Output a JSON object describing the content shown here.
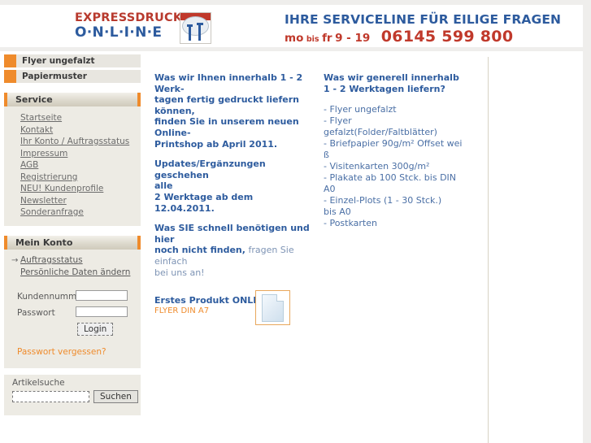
{
  "header": {
    "logo": {
      "line1": "EXPRESSDRUCK",
      "line2": "O·N·L·I·N·E",
      "mark_name": "speedometer-logo-icon"
    },
    "serviceline": {
      "headline": "IHRE SERVICELINE FÜR EILIGE FRAGEN",
      "days_from": "mo",
      "days_conj": "bis",
      "days_to": "fr",
      "hours": "9 - 19",
      "phone": "06145 599 800"
    }
  },
  "sidebar": {
    "categories": [
      {
        "label": "Flyer ungefalzt"
      },
      {
        "label": "Papiermuster"
      }
    ],
    "service": {
      "title": "Service",
      "items": [
        "Startseite",
        "Kontakt",
        "Ihr Konto / Auftragsstatus",
        "Impressum",
        "AGB",
        "Registrierung",
        "NEU! Kundenprofile",
        "Newsletter",
        "Sonderanfrage"
      ]
    },
    "account": {
      "title": "Mein Konto",
      "links": [
        {
          "label": "Auftragsstatus",
          "arrow": "→"
        },
        {
          "label": "Persönliche Daten ändern",
          "arrow": ""
        }
      ],
      "customer_number_label": "Kundennummer",
      "customer_number_value": "",
      "password_label": "Passwort",
      "password_value": "",
      "login_label": "Login",
      "forgot_label": "Passwort vergessen?"
    },
    "search": {
      "label": "Artikelsuche",
      "value": "",
      "button_label": "Suchen"
    }
  },
  "main": {
    "left": {
      "p1_l1": "Was wir Ihnen innerhalb 1 - 2 Werk-",
      "p1_l2": "tagen fertig gedruckt liefern",
      "p1_l3": "können,",
      "p1_l4": "finden Sie in unserem neuen",
      "p1_l5": "Online-",
      "p1_l6": "Printshop ab April 2011.",
      "p2_l1": "Updates/Ergänzungen geschehen",
      "p2_l2": "alle",
      "p2_l3": "2 Werktage ab dem 12.04.2011.",
      "p3_bold_l1": "Was SIE schnell benötigen und hier",
      "p3_bold_l2": "noch nicht finden,",
      "p3_soft_l2": " fragen Sie einfach",
      "p3_soft_l3": "bei uns an!"
    },
    "right": {
      "head_l1": "Was wir generell innerhalb",
      "head_l2": "1 - 2 Werktagen liefern?",
      "items": [
        "- Flyer ungefalzt",
        "- Flyer",
        "gefalzt(Folder/Faltblätter)",
        "- Briefpapier 90g/m² Offset wei",
        "ß",
        "- Visitenkarten 300g/m²",
        "- Plakate ab 100 Stck. bis DIN",
        "A0",
        "- Einzel-Plots (1 - 30 Stck.)",
        "bis A0",
        "- Postkarten"
      ]
    },
    "product": {
      "title": "Erstes Produkt ONLINE",
      "subtitle": "FLYER DIN A7",
      "thumb_name": "flyer-document-thumbnail"
    }
  },
  "colors": {
    "brand_red": "#b83a2e",
    "brand_blue": "#2d5b9e",
    "accent_orange": "#ef8b2c",
    "panel_bg": "#edebe4"
  }
}
